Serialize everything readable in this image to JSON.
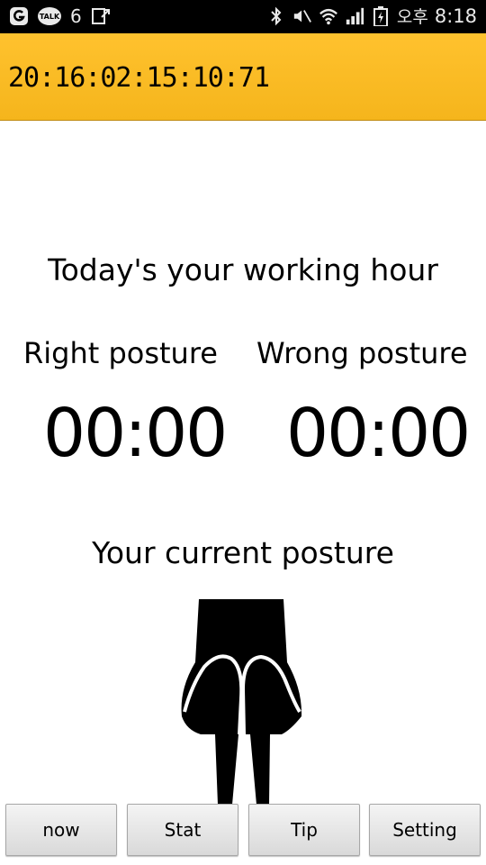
{
  "status_bar": {
    "notification_count": "6",
    "talk_label": "TALK",
    "ampm": "오후",
    "time": "8:18"
  },
  "action_bar": {
    "title": "20:16:02:15:10:71",
    "color": "#FFBF27"
  },
  "main": {
    "working_hour_heading": "Today's your working hour",
    "right_posture_label": "Right posture",
    "wrong_posture_label": "Wrong posture",
    "right_posture_time": "00:00",
    "wrong_posture_time": "00:00",
    "current_posture_heading": "Your current posture"
  },
  "nav_buttons": {
    "now": "now",
    "stat": "Stat",
    "tip": "Tip",
    "setting": "Setting"
  }
}
